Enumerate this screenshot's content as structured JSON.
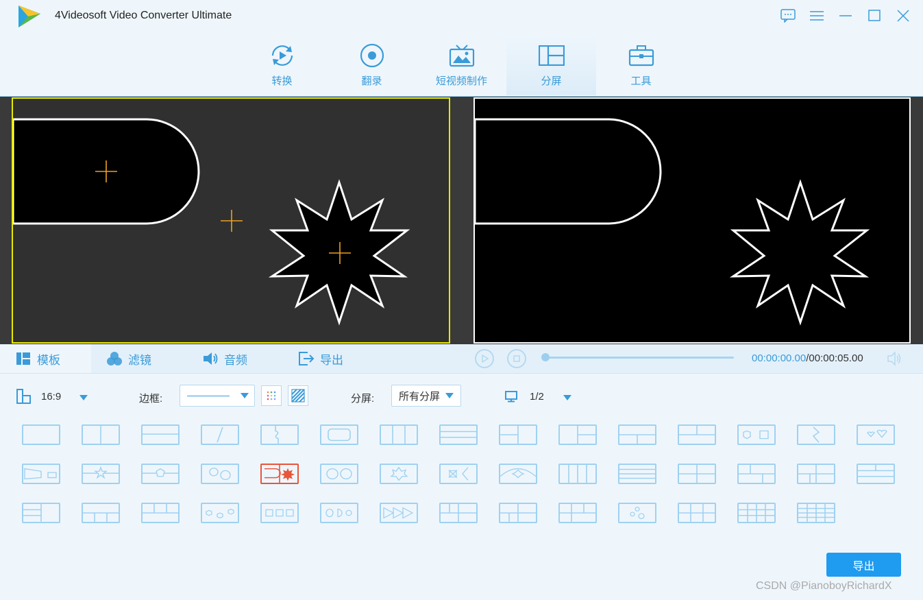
{
  "app": {
    "title": "4Videosoft Video Converter Ultimate"
  },
  "nav": {
    "tabs": [
      {
        "label": "转换",
        "icon": "convert-icon"
      },
      {
        "label": "翻录",
        "icon": "rip-icon"
      },
      {
        "label": "短视频制作",
        "icon": "mv-icon"
      },
      {
        "label": "分屏",
        "icon": "split-screen-icon",
        "active": true
      },
      {
        "label": "工具",
        "icon": "toolbox-icon"
      }
    ]
  },
  "subtabs": [
    {
      "label": "模板",
      "icon": "template-icon",
      "active": true
    },
    {
      "label": "滤镜",
      "icon": "filter-icon"
    },
    {
      "label": "音频",
      "icon": "audio-icon"
    },
    {
      "label": "导出",
      "icon": "export-icon"
    }
  ],
  "player": {
    "current_time": "00:00:00.00",
    "total_time": "/00:00:05.00",
    "progress": 0
  },
  "settings": {
    "aspect_ratio": "16:9",
    "border_label": "边框:",
    "split_label": "分屏:",
    "split_value": "所有分屏",
    "page_indicator": "1/2"
  },
  "templates": {
    "count": 44,
    "selected_index": 19
  },
  "colors": {
    "accent": "#3a9bd8",
    "selected_template": "#e8553a",
    "export_button": "#1f9bf0",
    "selection_border": "#e8e800"
  },
  "export_button": {
    "label": "导出"
  },
  "watermark": "CSDN @PianoboyRichardX"
}
